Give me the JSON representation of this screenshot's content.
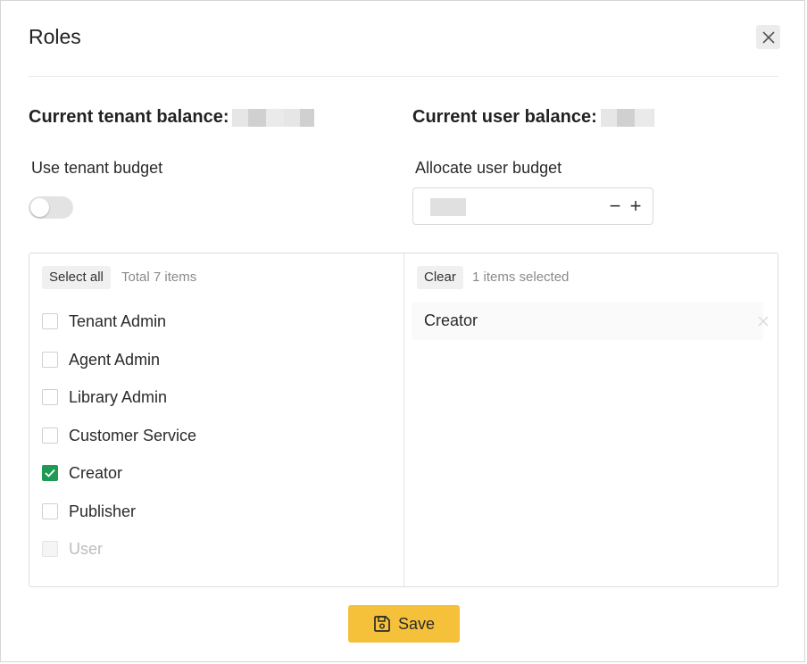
{
  "modal": {
    "title": "Roles",
    "close_icon": "close-icon"
  },
  "balances": {
    "tenant_label": "Current tenant balance:",
    "user_label": "Current user balance:"
  },
  "tenant_budget": {
    "label": "Use tenant budget",
    "enabled": false
  },
  "user_budget": {
    "label": "Allocate user budget",
    "minus_symbol": "−",
    "plus_symbol": "+"
  },
  "transfer": {
    "left": {
      "select_all_label": "Select all",
      "count_text": "Total 7 items",
      "options": [
        {
          "label": "Tenant Admin",
          "checked": false,
          "disabled": false
        },
        {
          "label": "Agent Admin",
          "checked": false,
          "disabled": false
        },
        {
          "label": "Library Admin",
          "checked": false,
          "disabled": false
        },
        {
          "label": "Customer Service",
          "checked": false,
          "disabled": false
        },
        {
          "label": "Creator",
          "checked": true,
          "disabled": false
        },
        {
          "label": "Publisher",
          "checked": false,
          "disabled": false
        },
        {
          "label": "User",
          "checked": false,
          "disabled": true
        }
      ]
    },
    "right": {
      "clear_label": "Clear",
      "count_text": "1 items selected",
      "selected": [
        "Creator"
      ]
    }
  },
  "footer": {
    "save_label": "Save",
    "save_icon": "save-icon",
    "accent_color": "#f5c03a",
    "check_color": "#1f9a55"
  }
}
